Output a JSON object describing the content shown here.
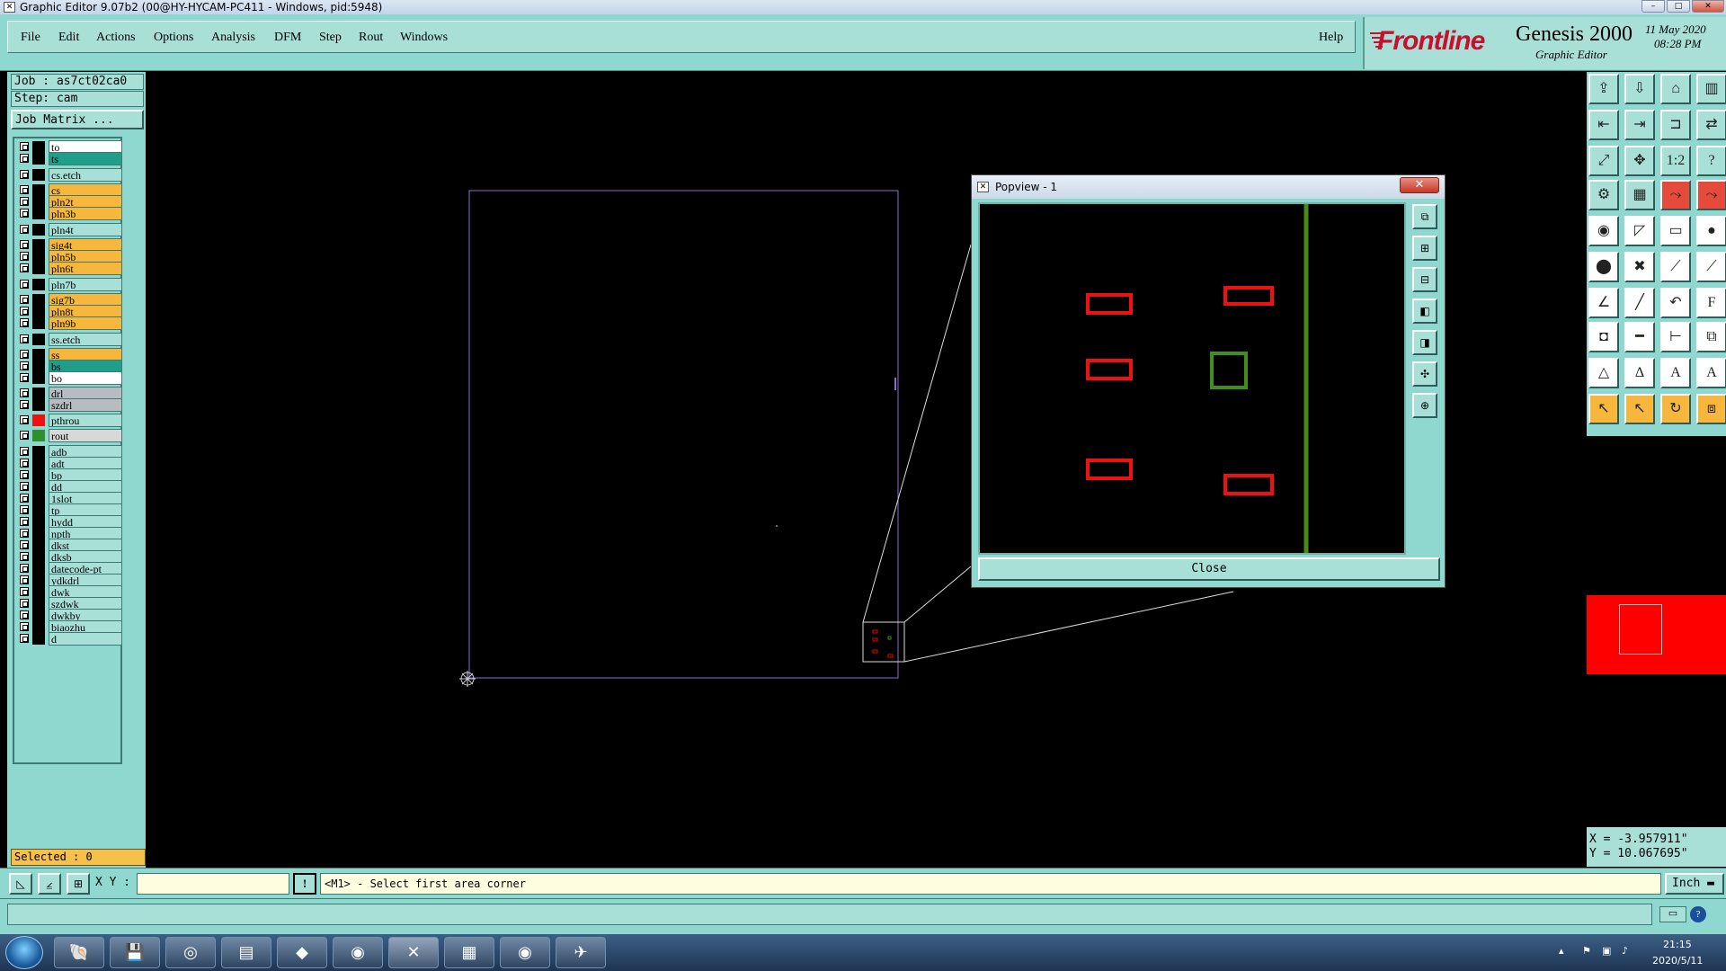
{
  "window": {
    "title": "Graphic Editor 9.07b2 (00@HY-HYCAM-PC411 - Windows, pid:5948)"
  },
  "menubar": {
    "items": [
      "File",
      "Edit",
      "Actions",
      "Options",
      "Analysis",
      "DFM",
      "Step",
      "Rout",
      "Windows"
    ],
    "help": "Help"
  },
  "brand": {
    "logo": "Frontline",
    "product": "Genesis 2000",
    "subtitle": "Graphic Editor",
    "date": "11 May 2020",
    "time": "08:28 PM"
  },
  "left": {
    "job": "Job : as7ct02ca0",
    "step": "Step: cam",
    "job_matrix": "Job Matrix ...",
    "selected": "Selected : 0",
    "layers": [
      {
        "name": "to",
        "color": "#ffffff"
      },
      {
        "name": "ts",
        "color": "#1f9e8a"
      },
      {
        "name": "cs.etch",
        "color": "#a8e0d8"
      },
      {
        "name": "cs",
        "color": "#f6b73c"
      },
      {
        "name": "pln2t",
        "color": "#f6b73c"
      },
      {
        "name": "pln3b",
        "color": "#f6b73c"
      },
      {
        "name": "pln4t",
        "color": "#a8e0d8"
      },
      {
        "name": "sig4t",
        "color": "#f6b73c"
      },
      {
        "name": "pln5b",
        "color": "#f6b73c"
      },
      {
        "name": "pln6t",
        "color": "#f6b73c"
      },
      {
        "name": "pln7b",
        "color": "#a8e0d8"
      },
      {
        "name": "sig7b",
        "color": "#f6b73c"
      },
      {
        "name": "pln8t",
        "color": "#f6b73c"
      },
      {
        "name": "pln9b",
        "color": "#f6b73c"
      },
      {
        "name": "ss.etch",
        "color": "#a8e0d8"
      },
      {
        "name": "ss",
        "color": "#f6b73c"
      },
      {
        "name": "bs",
        "color": "#1f9e8a"
      },
      {
        "name": "bo",
        "color": "#ffffff"
      },
      {
        "name": "drl",
        "color": "#b8bcc0"
      },
      {
        "name": "szdrl",
        "color": "#b8bcc0"
      },
      {
        "name": "pthrou",
        "color": "#a8e0d8"
      },
      {
        "name": "rout",
        "color": "#d8d8d8"
      },
      {
        "name": "adb",
        "color": "#a8e0d8"
      },
      {
        "name": "adt",
        "color": "#a8e0d8"
      },
      {
        "name": "bp",
        "color": "#a8e0d8"
      },
      {
        "name": "dd",
        "color": "#a8e0d8"
      },
      {
        "name": "1slot",
        "color": "#a8e0d8"
      },
      {
        "name": "tp",
        "color": "#a8e0d8"
      },
      {
        "name": "hydd",
        "color": "#a8e0d8"
      },
      {
        "name": "npth",
        "color": "#a8e0d8"
      },
      {
        "name": "dkst",
        "color": "#a8e0d8"
      },
      {
        "name": "dksb",
        "color": "#a8e0d8"
      },
      {
        "name": "datecode-pt",
        "color": "#a8e0d8"
      },
      {
        "name": "ydkdrl",
        "color": "#a8e0d8"
      },
      {
        "name": "dwk",
        "color": "#a8e0d8"
      },
      {
        "name": "szdwk",
        "color": "#a8e0d8"
      },
      {
        "name": "dwkby",
        "color": "#a8e0d8"
      },
      {
        "name": "biaozhu",
        "color": "#a8e0d8"
      },
      {
        "name": "d",
        "color": "#a8e0d8"
      }
    ]
  },
  "popview": {
    "title": "Popview - 1",
    "close_label": "Close"
  },
  "coords": {
    "x": "X = -3.957911\"",
    "y": "Y = 10.067695\""
  },
  "status": {
    "xy_label": "X Y :",
    "xy_value": "",
    "prompt": "<M1> - Select first area corner",
    "units": "Inch",
    "excl": "!"
  },
  "taskbar": {
    "time": "21:15",
    "date": "2020/5/11"
  }
}
